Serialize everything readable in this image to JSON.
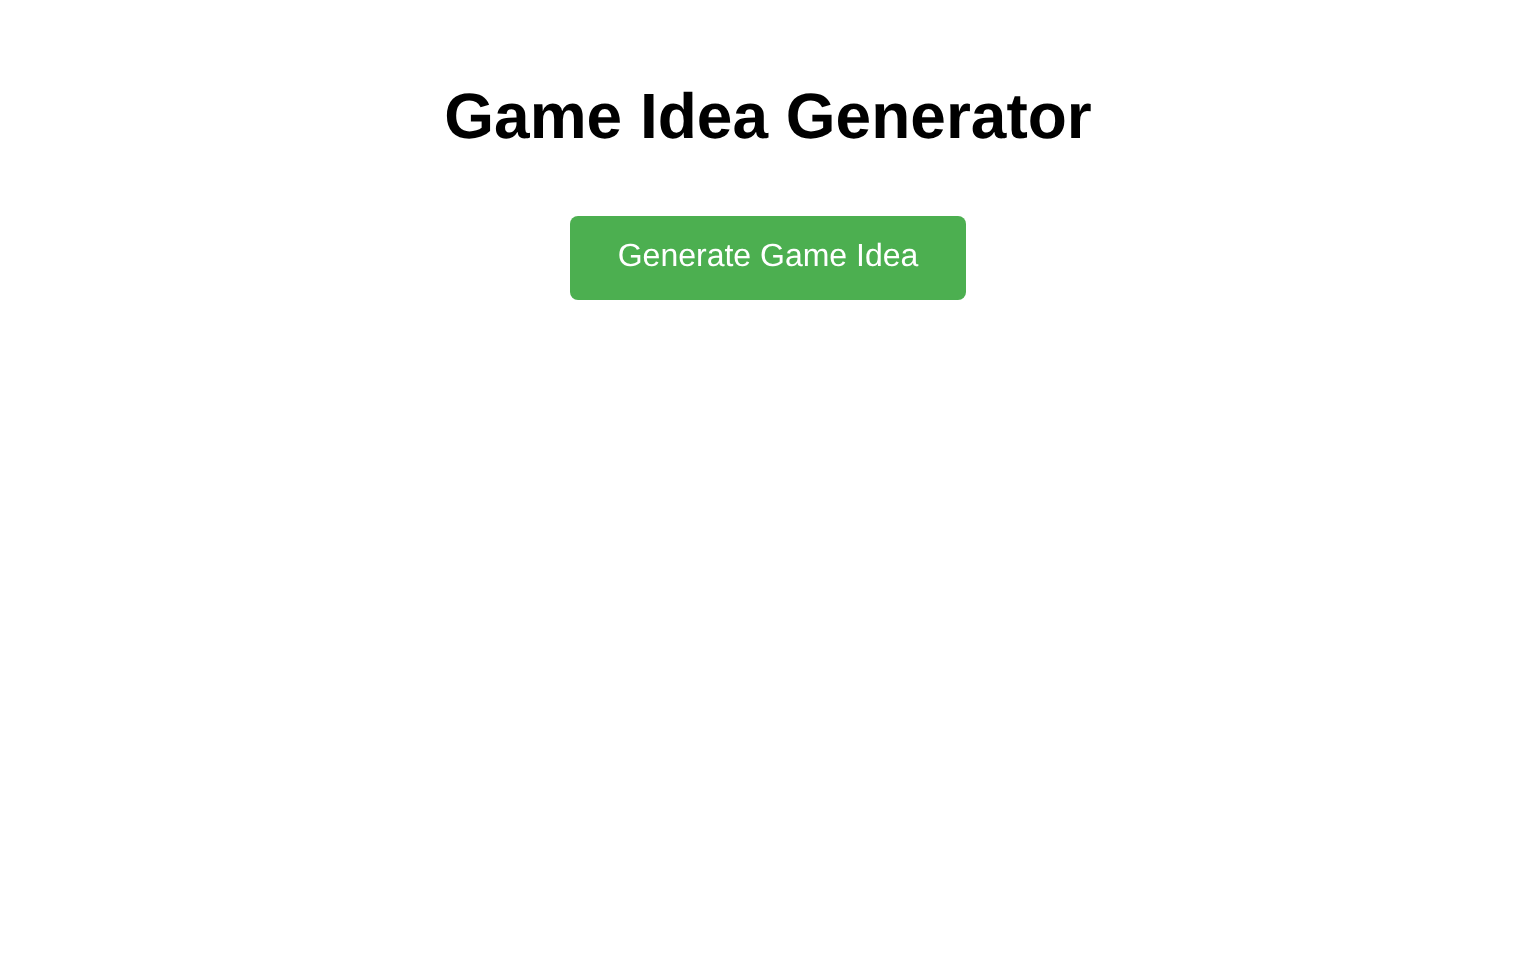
{
  "title": "Game Idea Generator",
  "button": {
    "label": "Generate Game Idea"
  }
}
